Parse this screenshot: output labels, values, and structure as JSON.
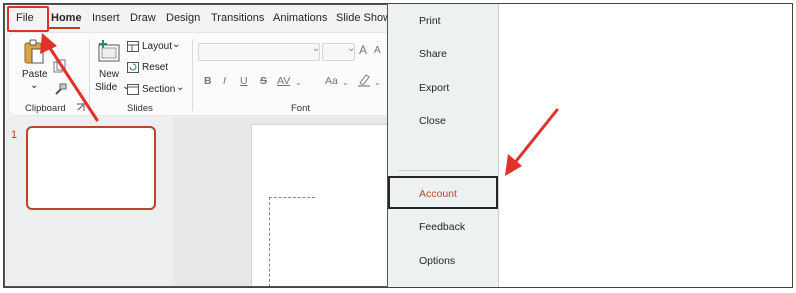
{
  "menu": {
    "file": "File",
    "home": "Home",
    "insert": "Insert",
    "draw": "Draw",
    "design": "Design",
    "transitions": "Transitions",
    "animations": "Animations",
    "slide_show": "Slide Show"
  },
  "ribbon": {
    "clipboard": {
      "paste": "Paste",
      "paste_arrow": "⌄",
      "group": "Clipboard"
    },
    "slides": {
      "new": "New",
      "slide": "Slide",
      "layout": "Layout",
      "reset": "Reset",
      "section": "Section",
      "group": "Slides"
    },
    "font": {
      "group": "Font",
      "bold": "B",
      "italic": "I",
      "underline": "U",
      "strike": "S",
      "char_spacing": "AV",
      "change_case": "Aa",
      "grow": "A",
      "shrink": "A"
    }
  },
  "thumbnails": {
    "slide_number": "1"
  },
  "backstage": {
    "items": [
      "Print",
      "Share",
      "Export",
      "Close",
      "Account",
      "Feedback",
      "Options"
    ]
  },
  "colors": {
    "accent": "#c43e1c",
    "annotation": "#e0312b"
  }
}
